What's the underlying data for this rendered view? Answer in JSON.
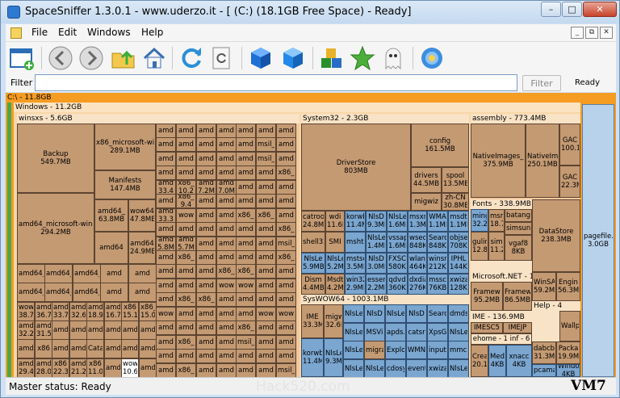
{
  "title": "SpaceSniffer 1.3.0.1 - www.uderzo.it - [ (C:) (18.1GB Free Space) - Ready]",
  "window_buttons": {
    "minimize": "–",
    "maximize": "□",
    "close": "✕"
  },
  "menu": {
    "file": "File",
    "edit": "Edit",
    "windows": "Windows",
    "help": "Help"
  },
  "mdi": {
    "minimize": "_",
    "restore": "⧉",
    "close": "✕"
  },
  "toolbar_icons": [
    "new-window-icon",
    "back-arrow-icon",
    "forward-arrow-icon",
    "folder-up-icon",
    "home-icon",
    "refresh-icon",
    "rescan-icon",
    "cube-blue-icon",
    "cube-blue-alt-icon",
    "cubes-tag-icon",
    "star-icon",
    "ghost-icon",
    "settings-flower-icon"
  ],
  "filter": {
    "label": "Filter",
    "value": "",
    "button": "Filter",
    "status": "Ready"
  },
  "treemap": {
    "root": "C:\\ - 11.8GB",
    "windows": "Windows - 11.2GB",
    "winsxs": "winsxs - 5.6GB",
    "system32": "System32 - 2.3GB",
    "syswow64": "SysWOW64 - 1003.1MB",
    "assembly": "assembly - 773.4MB",
    "fonts": "Fonts - 338.9MB",
    "microsoft_net": "Microsoft.NET - 1",
    "ime": "IME - 136.9MB",
    "help": "Help - 4",
    "ehome": "ehome - 1",
    "inf": "inf - 6",
    "cells": {
      "backup": "Backup\n549.7MB",
      "amd64_msw": "amd64_microsoft-windo\n294.2MB",
      "x86_msw": "x86_microsoft-wir\n289.1MB",
      "manifests": "Manifests\n147.4MB",
      "amd64_a": "amd64_\n63.8MB",
      "wow64_a": "wow64\n47.8MB",
      "amd64_b": "amd64\n24.9MB",
      "amd64_mi": "amd64_mi\n43.6MB",
      "driverstore": "DriverStore\n803MB",
      "config": "config\n161.5MB",
      "drivers": "drivers\n44.5MB",
      "spool": "spool\n13.5MB",
      "migwiz": "migwiz",
      "zhcn": "zh-CN\n30.8MB",
      "catroot": "catroot\n24.8MB",
      "wdi": "wdi\n11.6MB",
      "korwb": "korwb\n11.4MB",
      "nlsd": "NlsD\n9.3MB",
      "nlsle": "NlsLe\n1.6MB",
      "msxml": "msxm\n1.3MB",
      "wma": "WMA\n1.1MB",
      "msdt": "msdt\n1.1MB",
      "shell32": "shell32.",
      "smi": "SMI",
      "mshtml": "mshtm",
      "nlsle2": "NlsLe\n1.4MB",
      "vssapi": "vssap\n1.6MB",
      "wseo": "wseo\n848KB",
      "search": "Searc\n848KB",
      "objse": "objse\n708KB",
      "nlsle3": "NlsLe\n5.9MB",
      "nlsle4": "NlsLe\n5.2MB",
      "mstsc": "mstsc\n3.5MB",
      "nlsd2": "NlsD\n3.0MB",
      "fxsc": "FXSC\n580KB",
      "wlanc": "wlan\n464KB",
      "winsr": "winsr\n212KB",
      "iphl": "IPHL\n144KB",
      "dism": "Dism\n4.4MB",
      "msdt2": "Msdt\n4.2MB",
      "win32": "win32\n2.9MB",
      "essent": "essen\n2.2MB",
      "qdvd": "qdvd\n360KB",
      "dxdiag": "dxdia\n276KB",
      "msscr": "mssc\n76KB",
      "xwiza": "xwiza\n128KB",
      "ime_sw": "IME\n33.3MB",
      "migw": "migw\n32.6MB",
      "nlsle5": "NlsLe",
      "nlsd3": "NlsD",
      "search2": "Searc",
      "dmds": "dmds",
      "msvi": "MSVi",
      "apds": "apds.",
      "catsr": "catsr",
      "xpsg": "XpsG",
      "korwb2": "korwb\n11.4MB",
      "nlsle6": "NlsLe\n9.3MB",
      "migra": "migra",
      "explo": "Explo",
      "wmn": "WMN",
      "input": "input.",
      "mmc": "mmc.",
      "nlsle7": "NlsLe",
      "cdosy": "cdosy",
      "event": "event",
      "xwiza2": "xwiza",
      "nativeimages": "NativeImages_\n375.9MB",
      "nativeim2": "NativeIm\n250.1MB",
      "gac1": "GAC\n100.1",
      "gac2": "GAC\n22.3M",
      "datastore": "DataStore\n238.3MB",
      "pagefile": "pagefile.\n3.0GB",
      "ming1": "ming\n32.2",
      "msmin": "msm\n18.7",
      "batang": "batang",
      "simsun": "simsun",
      "gulin": "gulin\n12.8",
      "sim2": "sim\n11.2",
      "vgaf": "vgaf8\n8KB",
      "framew1": "Framew\n95.2MB",
      "framew2": "Framew\n86.5MB",
      "winsa": "WinSA\n59.2M",
      "engine": "Engin\n56.3M",
      "wallp": "Wallp",
      "imesc5": "IMESC5",
      "imejp": "IMEJP",
      "dabcb": "dabcb.\n31.3M",
      "packa": "Packa\n19.9M",
      "crea": "Crea\n20.1",
      "medi": "Medi\n4KB",
      "xnacc": "xnacc\n4KB",
      "pcama": "pcama",
      "windo": "Windo\n4KB"
    },
    "winsxs_grid": [
      [
        "amd",
        "amd",
        "amd",
        "amd",
        "amd",
        "amd",
        "amd"
      ],
      [
        "amd",
        "amd",
        "amd",
        "amd",
        "amd",
        "msil_",
        "amd"
      ],
      [
        "amd",
        "amd",
        "amd",
        "amd",
        "amd",
        "msil_",
        "amd"
      ],
      [
        "amd",
        "amd",
        "amd",
        "amd",
        "amd",
        "amd",
        "x86_"
      ],
      [
        "amd\n33.4",
        "x86_\n10.2",
        "amd\n7.2M",
        "amd\n7.0M",
        "amd",
        "amd",
        "amd"
      ],
      [
        "amd",
        "x86_\n9.4",
        "amd",
        "amd",
        "amd",
        "amd",
        "amd"
      ],
      [
        "amd\n33.3",
        "wow",
        "amd",
        "amd",
        "x86_",
        "x86_",
        "amd"
      ],
      [
        "amd",
        "amd",
        "amd",
        "amd",
        "amd",
        "amd",
        "x86_"
      ],
      [
        "amd\n5.8M",
        "amd\n5.7M",
        "amd",
        "amd",
        "amd",
        "amd",
        "msil_"
      ],
      [
        "amd",
        "x86_",
        "amd",
        "amd",
        "amd",
        "amd",
        "x86_"
      ],
      [
        "amd",
        "amd",
        "amd",
        "x86_",
        "x86_",
        "amd",
        "amd"
      ],
      [
        "amd",
        "amd",
        "amd",
        "wow",
        "wow",
        "amd",
        "amd"
      ],
      [
        "amd",
        "x86_",
        "x86_",
        "amd",
        "amd",
        "amd",
        "amd"
      ],
      [
        "wow",
        "amd",
        "amd",
        "amd",
        "amd",
        "wow",
        "wow"
      ],
      [
        "amd",
        "amd",
        "amd",
        "amd",
        "x86_",
        "amd",
        "amd"
      ],
      [
        "amd",
        "x86_",
        "amd",
        "amd",
        "msil_",
        "amd",
        "amd"
      ],
      [
        "amd",
        "amd",
        "amd",
        "amd",
        "amd",
        "amd",
        "amd"
      ],
      [
        "amd",
        "x86_",
        "amd",
        "amd",
        "amd",
        "amd",
        "msil_"
      ]
    ],
    "winsxs_left": [
      [
        "amd64_m",
        "amd64_m",
        "amd64_m",
        "amd",
        "amd"
      ],
      [
        "amd64_m",
        "amd64_m",
        "amd64_m",
        "amd",
        "amd"
      ],
      [
        "wow\n38.7M",
        "amd\n36.7",
        "amd\n33.7",
        "amd\n32.6",
        "amd64\n18.9",
        "amd64\n16.7",
        "x86\n15.1",
        "x86_\n15.0"
      ],
      [
        "amd\n32.2",
        "amd\n31.5",
        "amd",
        "amd",
        "amd",
        "amd",
        "amd",
        "amd"
      ],
      [
        "amd",
        "x86",
        "amd",
        "amd",
        "Catal",
        "amd",
        "amd",
        "amd"
      ],
      [
        "amd\n29.4",
        "amd\n28.0",
        "x86\n22.3",
        "amd\n21.2",
        "x86\n11.0",
        "amd",
        "wow\n10.6",
        "amd"
      ]
    ]
  },
  "status": {
    "master": "Master status: Ready",
    "watermark": "Hack520.com",
    "badge": "VM7"
  }
}
